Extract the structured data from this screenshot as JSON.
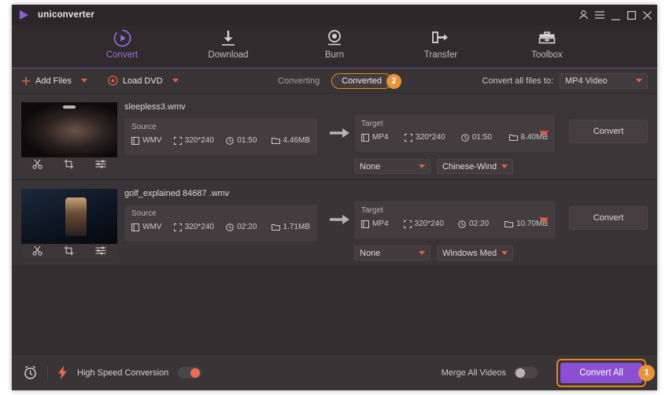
{
  "app": {
    "brand": "uniconverter",
    "logo_icon": "play-triangle-icon",
    "window_controls": {
      "account": "account-icon",
      "menu": "hamburger-menu-icon",
      "minimize": "minimize-icon",
      "maximize": "maximize-icon",
      "close": "close-icon"
    }
  },
  "nav": {
    "items": [
      {
        "label": "Convert",
        "icon": "convert-circle-play-icon",
        "active": true
      },
      {
        "label": "Download",
        "icon": "download-arrow-icon",
        "active": false
      },
      {
        "label": "Burn",
        "icon": "burn-disc-icon",
        "active": false
      },
      {
        "label": "Transfer",
        "icon": "transfer-device-icon",
        "active": false
      },
      {
        "label": "Toolbox",
        "icon": "toolbox-icon",
        "active": false
      }
    ]
  },
  "toolbar": {
    "add_files": {
      "label": "Add Files",
      "icon": "plus-icon",
      "caret": "chevron-down-icon"
    },
    "load_dvd": {
      "label": "Load DVD",
      "icon": "disc-icon",
      "caret": "chevron-down-icon"
    },
    "tabs": [
      {
        "label": "Converting",
        "active": false
      },
      {
        "label": "Converted",
        "active": true
      }
    ],
    "tab_badge": "2",
    "convert_all_to_label": "Convert all files to:",
    "convert_all_to_value": "MP4 Video"
  },
  "files": [
    {
      "name": "sleepless3.wmv",
      "thumb_tools": [
        "trim-scissors-icon",
        "crop-icon",
        "effects-sliders-icon"
      ],
      "source": {
        "title": "Source",
        "format": "WMV",
        "resolution": "320*240",
        "duration": "01:50",
        "size": "4.46MB"
      },
      "target": {
        "title": "Target",
        "format": "MP4",
        "resolution": "320*240",
        "duration": "01:50",
        "size": "8.40MB"
      },
      "subtitle_select": "None",
      "audio_select": "Chinese-Windo...",
      "convert_label": "Convert"
    },
    {
      "name": "golf_explained 84687 .wmv",
      "thumb_tools": [
        "trim-scissors-icon",
        "crop-icon",
        "effects-sliders-icon"
      ],
      "source": {
        "title": "Source",
        "format": "WMV",
        "resolution": "320*240",
        "duration": "02:20",
        "size": "1.71MB"
      },
      "target": {
        "title": "Target",
        "format": "MP4",
        "resolution": "320*240",
        "duration": "02:20",
        "size": "10.70MB"
      },
      "subtitle_select": "None",
      "audio_select": "Windows Medi...",
      "convert_label": "Convert"
    }
  ],
  "bottom": {
    "schedule_icon": "alarm-clock-icon",
    "speed_icon": "lightning-bolt-icon",
    "high_speed_label": "High Speed Conversion",
    "high_speed_on": true,
    "merge_label": "Merge All Videos",
    "merge_on": false,
    "convert_all_label": "Convert All",
    "convert_all_badge": "1"
  },
  "colors": {
    "accent_purple": "#8b4fd4",
    "accent_orange": "#e8841f",
    "toggle_on": "#ed6b4d",
    "window_bg": "#302c2e",
    "row_bg": "#3a3537"
  }
}
